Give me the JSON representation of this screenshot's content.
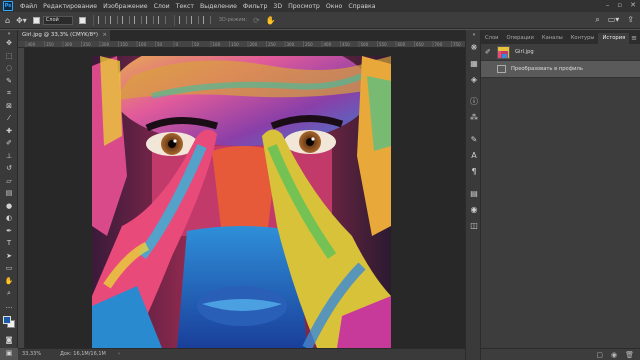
{
  "menubar": {
    "logo": "Ps",
    "items": [
      "Файл",
      "Редактирование",
      "Изображение",
      "Слои",
      "Текст",
      "Выделение",
      "Фильтр",
      "3D",
      "Просмотр",
      "Окно",
      "Справка"
    ]
  },
  "options": {
    "auto_select_label": "Слой",
    "mode_3d_label": "3D-режим:"
  },
  "document": {
    "tab_title": "Girl.jpg @ 33,3% (CMYK/8*)",
    "close_glyph": "×",
    "ruler_marks": [
      "400",
      "350",
      "300",
      "250",
      "200",
      "150",
      "100",
      "50",
      "0",
      "50",
      "100",
      "150",
      "200",
      "250",
      "300",
      "350",
      "400",
      "450",
      "500",
      "550",
      "600",
      "650",
      "700",
      "750"
    ]
  },
  "status": {
    "zoom": "33,33%",
    "doc_size": "Док: 16,1M/16,1M"
  },
  "panel": {
    "tabs": [
      "Слои",
      "Операции",
      "Каналы",
      "Контуры",
      "История"
    ],
    "active_tab": "История",
    "history": {
      "snapshot_label": "Girl.jpg",
      "steps": [
        "Преобразовать в профиль"
      ]
    }
  },
  "colors": {
    "accent": "#31a8ff",
    "foreground_color": "#1b5aa8",
    "background_color": "#f0f0f0"
  }
}
